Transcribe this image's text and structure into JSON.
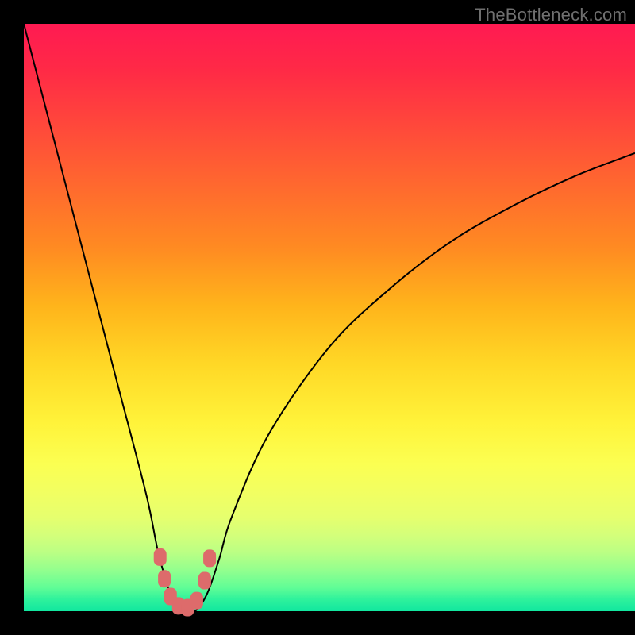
{
  "watermark": "TheBottleneck.com",
  "colors": {
    "background": "#000000",
    "gradient_top": "#ff1a52",
    "gradient_bottom": "#11e79f",
    "curve_stroke": "#000000",
    "marker_fill": "#dd6b6b"
  },
  "chart_data": {
    "type": "line",
    "title": "",
    "xlabel": "",
    "ylabel": "",
    "xlim": [
      0,
      100
    ],
    "ylim": [
      0,
      100
    ],
    "grid": false,
    "legend": false,
    "series": [
      {
        "name": "bottleneck-curve",
        "x": [
          0,
          5,
          10,
          15,
          20,
          22,
          24,
          26,
          28,
          30,
          32,
          34,
          40,
          50,
          60,
          70,
          80,
          90,
          100
        ],
        "y": [
          100,
          80,
          60,
          40,
          20,
          10,
          3,
          0,
          0,
          3,
          9,
          16,
          30,
          45,
          55,
          63,
          69,
          74,
          78
        ]
      }
    ],
    "markers": [
      {
        "x": 22.3,
        "y": 9.2
      },
      {
        "x": 23.0,
        "y": 5.5
      },
      {
        "x": 24.0,
        "y": 2.5
      },
      {
        "x": 25.3,
        "y": 0.9
      },
      {
        "x": 26.8,
        "y": 0.6
      },
      {
        "x": 28.3,
        "y": 1.8
      },
      {
        "x": 29.6,
        "y": 5.2
      },
      {
        "x": 30.4,
        "y": 9.0
      }
    ],
    "notes": "y represents bottleneck percentage (0=green bottom, 100=red top); x is an arbitrary normalized axis. Curve has a sharp minimum near x≈27. Right branch is less steep, peaking near y≈78 at x=100. Markers are pink/red rounded squares placed along the curve near the minimum."
  }
}
